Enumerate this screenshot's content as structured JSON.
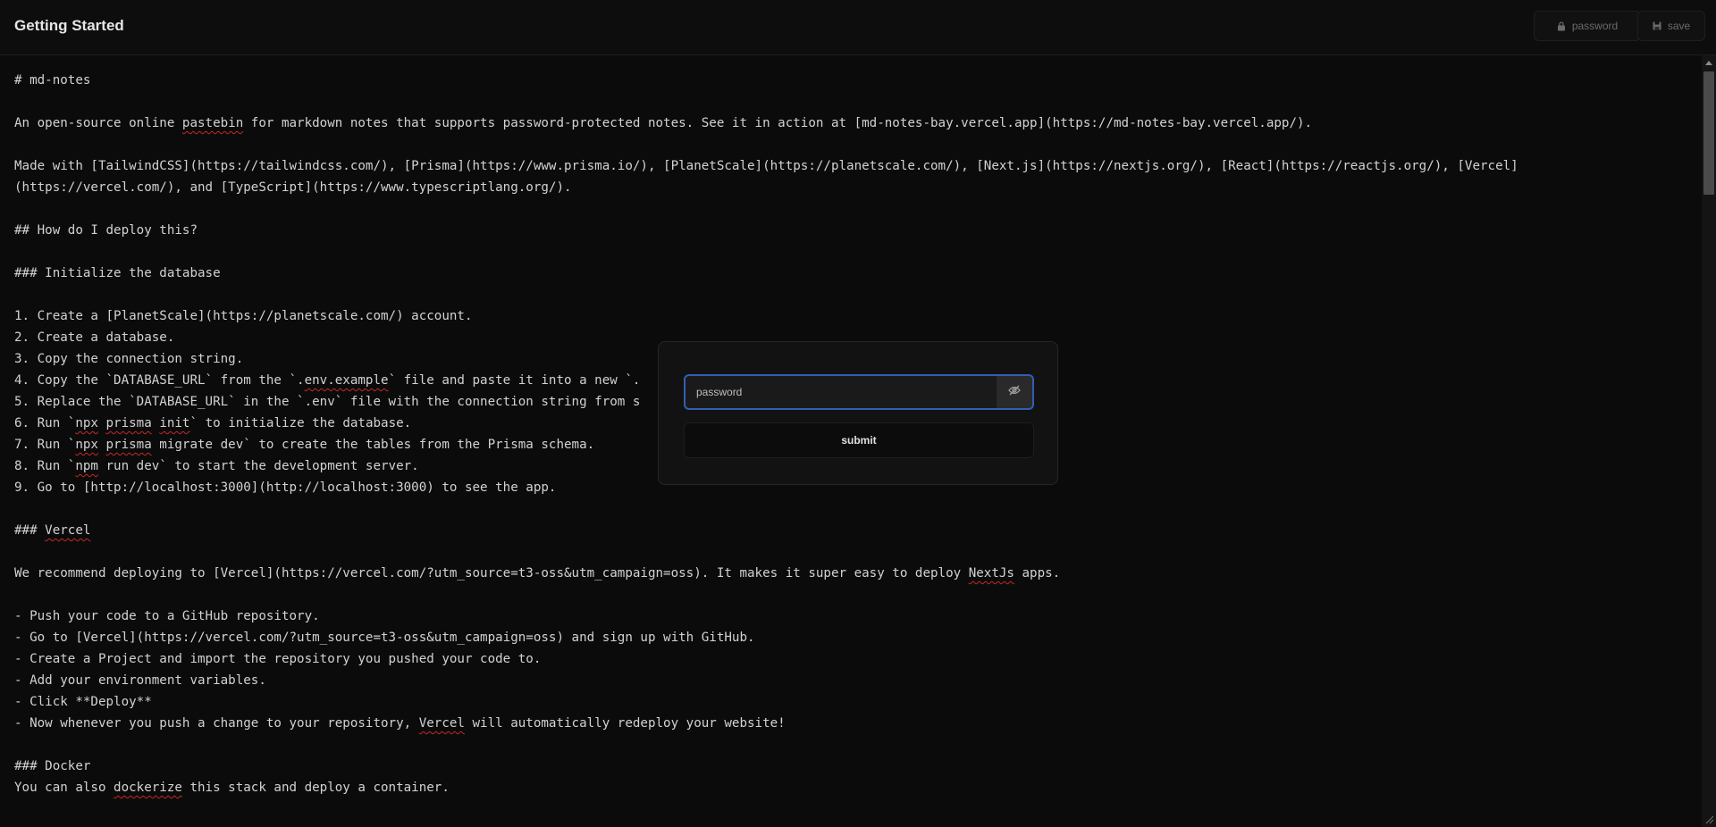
{
  "header": {
    "title": "Getting Started",
    "password_label": "password",
    "save_label": "save"
  },
  "editor": {
    "lines": [
      [
        {
          "t": "# md-notes"
        }
      ],
      [],
      [
        {
          "t": "An open-source online "
        },
        {
          "t": "pastebin",
          "sp": true
        },
        {
          "t": " for markdown notes that supports password-protected notes. See it in action at [md-notes-bay.vercel.app](https://md-notes-bay.vercel.app/)."
        }
      ],
      [],
      [
        {
          "t": "Made with [TailwindCSS](https://tailwindcss.com/), [Prisma](https://www.prisma.io/), [PlanetScale](https://planetscale.com/), [Next.js](https://nextjs.org/), [React](https://reactjs.org/), [Vercel]"
        }
      ],
      [
        {
          "t": "(https://vercel.com/), and [TypeScript](https://www.typescriptlang.org/)."
        }
      ],
      [],
      [
        {
          "t": "## How do I deploy this?"
        }
      ],
      [],
      [
        {
          "t": "### Initialize the database"
        }
      ],
      [],
      [
        {
          "t": "1. Create a [PlanetScale](https://planetscale.com/) account."
        }
      ],
      [
        {
          "t": "2. Create a database."
        }
      ],
      [
        {
          "t": "3. Copy the connection string."
        }
      ],
      [
        {
          "t": "4. Copy the `DATABASE_URL` from the `."
        },
        {
          "t": "env.example",
          "sp": true
        },
        {
          "t": "` file and paste it into a new `."
        }
      ],
      [
        {
          "t": "5. Replace the `DATABASE_URL` in the `.env` file with the connection string from s"
        }
      ],
      [
        {
          "t": "6. Run `"
        },
        {
          "t": "npx",
          "sp": true
        },
        {
          "t": " "
        },
        {
          "t": "prisma",
          "sp": true
        },
        {
          "t": " "
        },
        {
          "t": "init",
          "sp": true
        },
        {
          "t": "` to initialize the database."
        }
      ],
      [
        {
          "t": "7. Run `"
        },
        {
          "t": "npx",
          "sp": true
        },
        {
          "t": " "
        },
        {
          "t": "prisma",
          "sp": true
        },
        {
          "t": " migrate dev` to create the tables from the Prisma schema."
        }
      ],
      [
        {
          "t": "8. Run `"
        },
        {
          "t": "npm",
          "sp": true
        },
        {
          "t": " run dev` to start the development server."
        }
      ],
      [
        {
          "t": "9. Go to [http://localhost:3000](http://localhost:3000) to see the app."
        }
      ],
      [],
      [
        {
          "t": "### "
        },
        {
          "t": "Vercel",
          "sp": true
        }
      ],
      [],
      [
        {
          "t": "We recommend deploying to [Vercel](https://vercel.com/?utm_source=t3-oss&utm_campaign=oss). It makes it super easy to deploy "
        },
        {
          "t": "NextJs",
          "sp": true
        },
        {
          "t": " apps."
        }
      ],
      [],
      [
        {
          "t": "- Push your code to a GitHub repository."
        }
      ],
      [
        {
          "t": "- Go to [Vercel](https://vercel.com/?utm_source=t3-oss&utm_campaign=oss) and sign up with GitHub."
        }
      ],
      [
        {
          "t": "- Create a Project and import the repository you pushed your code to."
        }
      ],
      [
        {
          "t": "- Add your environment variables."
        }
      ],
      [
        {
          "t": "- Click **Deploy**"
        }
      ],
      [
        {
          "t": "- Now whenever you push a change to your repository, "
        },
        {
          "t": "Vercel",
          "sp": true
        },
        {
          "t": " will automatically redeploy your website!"
        }
      ],
      [],
      [
        {
          "t": "### Docker"
        }
      ],
      [
        {
          "t": "You can also "
        },
        {
          "t": "dockerize",
          "sp": true
        },
        {
          "t": " this stack and deploy a container."
        }
      ]
    ]
  },
  "dialog": {
    "password_placeholder": "password",
    "password_value": "",
    "submit_label": "submit",
    "toggle_icon": "eye-off-icon"
  },
  "colors": {
    "background": "#0b0b0b",
    "focus_ring": "#2f5fb3",
    "spellcheck": "#c62828"
  }
}
